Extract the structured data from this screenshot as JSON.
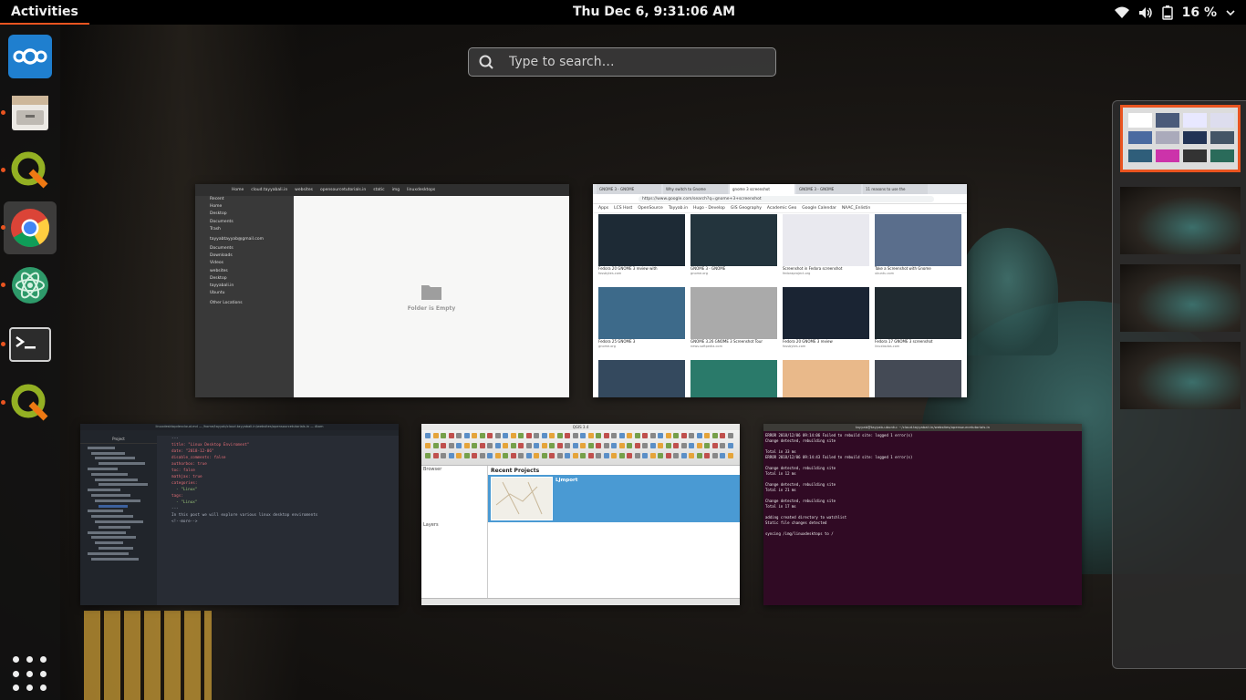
{
  "topbar": {
    "activities": "Activities",
    "clock": "Thu Dec  6,  9:31:06 AM",
    "battery_percent": "16 %"
  },
  "search": {
    "placeholder": "Type to search…"
  },
  "dash": {
    "items": [
      {
        "icon": "nextcloud-icon",
        "running": false
      },
      {
        "icon": "files-icon",
        "running": true
      },
      {
        "icon": "qgis-icon",
        "running": true
      },
      {
        "icon": "chrome-icon",
        "running": true,
        "focused": true
      },
      {
        "icon": "atom-icon",
        "running": true
      },
      {
        "icon": "terminal-icon",
        "running": true
      },
      {
        "icon": "qgis-icon",
        "running": true
      }
    ],
    "show_apps_icon": "grid-icon"
  },
  "windows": {
    "files": {
      "path": [
        "Home",
        "cloud.tayyabali.in",
        "websites",
        "opensourcetutorials.in",
        "static",
        "img",
        "linuxdesktops"
      ],
      "sidebar": [
        "Recent",
        "Home",
        "Desktop",
        "Documents",
        "Trash",
        "tayyabtayyab@gmail.com",
        "Documents",
        "Downloads",
        "Videos",
        "websites",
        "Desktop",
        "tayyabali.in",
        "Ubuntu",
        "Other Locations"
      ],
      "empty_label": "Folder is Empty"
    },
    "chrome": {
      "tabs": [
        "GNOME 3 - GNOME",
        "Why switch to Gnome",
        "gnome 3 screenshot",
        "GNOME 3 - GNOME",
        "11 reasons to use the"
      ],
      "url": "https://www.google.com/search?q=gnome+3+screenshot",
      "bookmarks": [
        "Apps",
        "LCS Host",
        "OpenSource",
        "Tayyab.in",
        "Hugo - Develop",
        "GIS Geography",
        "Academic Geo",
        "Google Calendar",
        "NAAC_Enlistin"
      ],
      "results": [
        {
          "caption": "Fedora 20 GNOME 3 review with",
          "source": "fossbytes.com"
        },
        {
          "caption": "GNOME 3 - GNOME",
          "source": "gnome.org"
        },
        {
          "caption": "Screenshot in Fedora screenshot",
          "source": "fedoraproject.org"
        },
        {
          "caption": "Take a Screenshot with Gnome",
          "source": "ubuntu.com"
        },
        {
          "caption": "Fedora 25 GNOME 3",
          "source": "gnome.org"
        },
        {
          "caption": "GNOME 3.26 GNOME 3 Screenshot Tour",
          "source": "news.softpedia.com"
        },
        {
          "caption": "Fedora 20 GNOME 3 review",
          "source": "fossbytes.com"
        },
        {
          "caption": "Fedora 17 GNOME 3 screenshot",
          "source": "linuxbsdos.com"
        }
      ]
    },
    "atom": {
      "title": "linuxdesktopdevcloud.md — /home/tayyab/cloud.tayyabali.in/websites/opensourcetutorials.in — Atom",
      "project_label": "Project",
      "code_lines": [
        "---",
        "title: \"Linux Desktop Enviroment\"",
        "date: \"2018-12-06\"",
        "disable_comments: false",
        "authorbox: true",
        "toc: false",
        "mathjax: true",
        "categories:",
        "  - \"Linux\"",
        "tags:",
        "  - \"Linux\"",
        "---",
        "",
        "In this post we will explore various linux desktop enviroments",
        "<!--more-->"
      ]
    },
    "qgis": {
      "title": "QGIS 3.4",
      "recent_projects": "Recent Projects",
      "project_name": "LJmport",
      "browser_label": "Browser",
      "layers_label": "Layers"
    },
    "terminal": {
      "title": "tayyab@tayyab-ubuntu: ~/cloud.tayyabali.in/websites/opensourcetutorials.in",
      "lines": [
        "ERROR 2018/12/06 09:14:06 Failed to rebuild site: logged 1 error(s)",
        "Change detected, rebuilding site",
        "Total in 33 ms",
        "ERROR 2018/12/06 09:14:43 Failed to rebuild site: logged 1 error(s)",
        "Change detected, rebuilding site",
        "Total in 12 ms",
        "Change detected, rebuilding site",
        "Total in 21 ms",
        "Change detected, rebuilding site",
        "Total in 17 ms",
        "adding created directory to watchlist",
        "Static file changes detected",
        "syncing /img/linuxdesktops to /"
      ]
    }
  },
  "workspaces": {
    "count": 4,
    "selected": 0
  }
}
